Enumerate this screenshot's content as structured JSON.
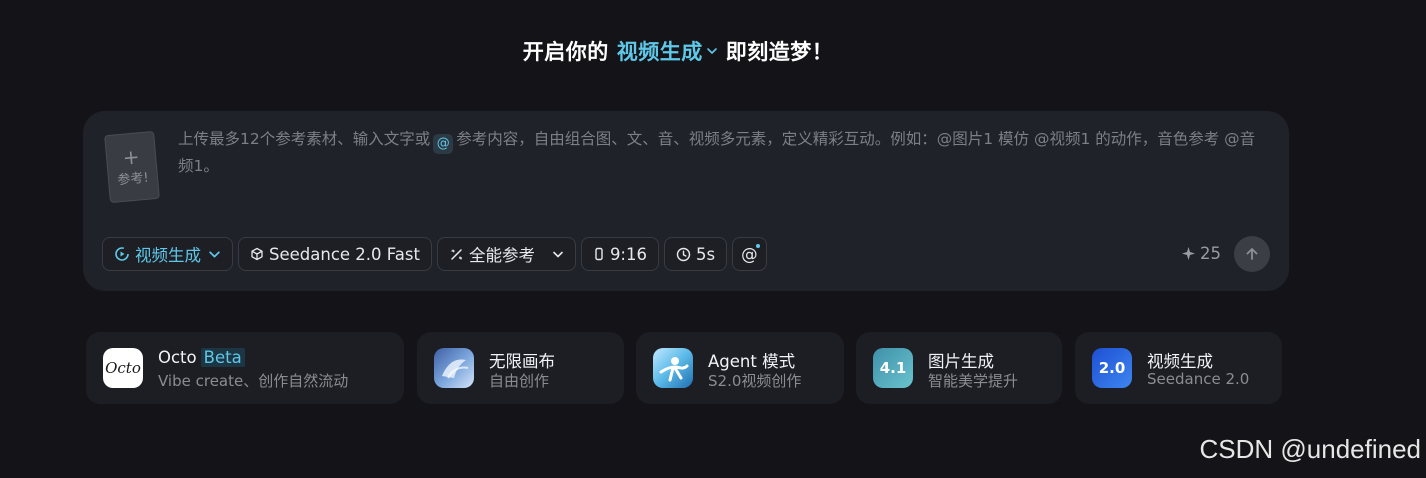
{
  "headline": {
    "prefix": "开启你的",
    "mode": "视频生成",
    "suffix": "即刻造梦！"
  },
  "prompt": {
    "ref_plus": "+",
    "ref_label": "参考!",
    "placeholder_part1": "上传最多12个参考素材、输入文字或",
    "at_symbol": "@",
    "placeholder_part2": "参考内容，自由组合图、文、音、视频多元素，定义精彩互动。例如：@图片1 模仿 @视频1 的动作，音色参考 @音频1。"
  },
  "toolbar": {
    "mode_label": "视频生成",
    "model_label": "Seedance 2.0 Fast",
    "reference_label": "全能参考",
    "ratio_label": "9:16",
    "duration_label": "5s",
    "mention_label": "@",
    "credits": "25"
  },
  "features": [
    {
      "title": "Octo",
      "badge": "Beta",
      "subtitle": "Vibe create、创作自然流动",
      "icon_text": "Octo"
    },
    {
      "title": "无限画布",
      "subtitle": "自由创作"
    },
    {
      "title": "Agent 模式",
      "subtitle": "S2.0视频创作"
    },
    {
      "title": "图片生成",
      "subtitle": "智能美学提升",
      "icon_text": "4.1"
    },
    {
      "title": "视频生成",
      "subtitle": "Seedance 2.0",
      "icon_text": "2.0"
    }
  ],
  "watermark": "CSDN @undefined",
  "colors": {
    "background": "#141418",
    "card": "#202229",
    "accent": "#5fc7e8"
  }
}
